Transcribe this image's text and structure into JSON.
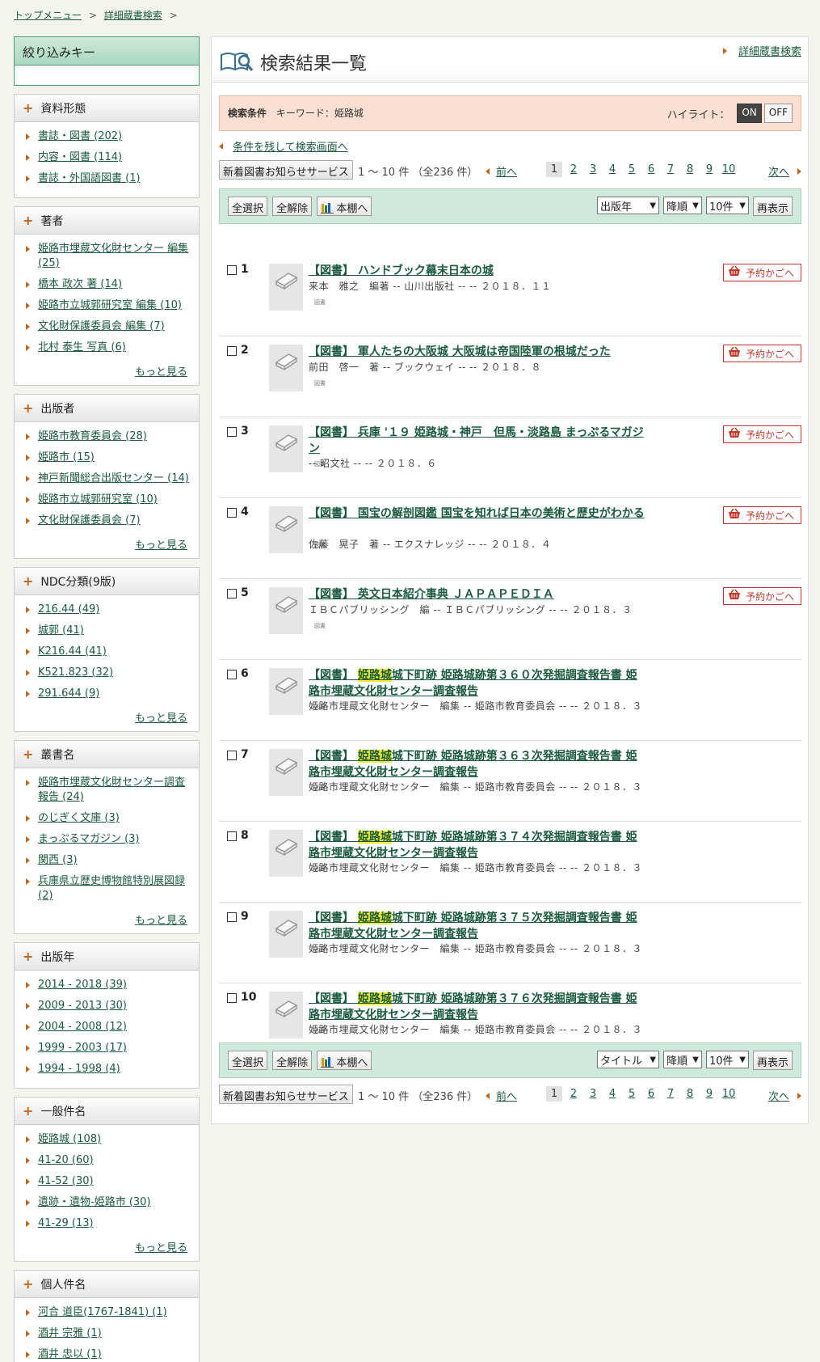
{
  "breadcrumb": {
    "items": [
      "トップメニュー",
      "詳細蔵書検索"
    ],
    "separator": ">"
  },
  "sidebar": {
    "title": "絞り込みキー",
    "more_label": "もっと見る",
    "facets": [
      {
        "title": "資料形態",
        "items": [
          "書誌・図書 (202)",
          "内容・図書 (114)",
          "書誌・外国語図書 (1)"
        ],
        "more": false
      },
      {
        "title": "著者",
        "items": [
          "姫路市埋蔵文化財センター 編集 (25)",
          "橋本 政次 著 (14)",
          "姫路市立城郭研究室 編集 (10)",
          "文化財保護委員会 編集 (7)",
          "北村 泰生 写真 (6)"
        ],
        "more": true
      },
      {
        "title": "出版者",
        "items": [
          "姫路市教育委員会 (28)",
          "姫路市 (15)",
          "神戸新聞総合出版センター (14)",
          "姫路市立城郭研究室 (10)",
          "文化財保護委員会 (7)"
        ],
        "more": true
      },
      {
        "title": "NDC分類(9版)",
        "items": [
          "216.44 (49)",
          "城郭 (41)",
          "K216.44 (41)",
          "K521.823 (32)",
          "291.644 (9)"
        ],
        "more": true
      },
      {
        "title": "叢書名",
        "items": [
          "姫路市埋蔵文化財センター調査報告 (24)",
          "のじぎく文庫 (3)",
          "まっぷるマガジン (3)",
          "関西 (3)",
          "兵庫県立歴史博物館特別展図録 (2)"
        ],
        "more": true
      },
      {
        "title": "出版年",
        "items": [
          "2014 - 2018 (39)",
          "2009 - 2013 (30)",
          "2004 - 2008 (12)",
          "1999 - 2003 (17)",
          "1994 - 1998 (4)"
        ],
        "more": false
      },
      {
        "title": "一般件名",
        "items": [
          "姫路城 (108)",
          "41-20 (60)",
          "41-52 (30)",
          "遺跡・遺物-姫路市 (30)",
          "41-29 (13)"
        ],
        "more": true
      },
      {
        "title": "個人件名",
        "items": [
          "河合 道臣(1767-1841) (1)",
          "酒井 宗雅 (1)",
          "酒井 忠以 (1)"
        ],
        "more": false
      }
    ]
  },
  "main": {
    "title": "検索結果一覧",
    "adv_search_link": "詳細蔵書検索",
    "condition": {
      "label": "検索条件",
      "text": "キーワード：姫路城",
      "highlight_label": "ハイライト：",
      "on_label": "ON",
      "off_label": "OFF"
    },
    "back_link": "条件を残して検索画面へ",
    "pager": {
      "service_button": "新着図書お知らせサービス",
      "range_text": "1 ～ 10 件 （全236 件）",
      "prev_label": "前へ",
      "next_label": "次へ",
      "pages": [
        "1",
        "2",
        "3",
        "4",
        "5",
        "6",
        "7",
        "8",
        "9",
        "10"
      ],
      "current_page": "1"
    },
    "toolbar_top": {
      "select_all": "全選択",
      "deselect_all": "全解除",
      "shelf": "本棚へ",
      "sort_field": "出版年",
      "sort_order": "降順",
      "per_page": "10件",
      "redisplay": "再表示"
    },
    "toolbar_bottom": {
      "select_all": "全選択",
      "deselect_all": "全解除",
      "shelf": "本棚へ",
      "sort_field": "タイトル",
      "sort_order": "降順",
      "per_page": "10件",
      "redisplay": "再表示"
    },
    "thumb_caption": "図書",
    "reserve_label": "予約かごへ",
    "results": [
      {
        "num": "1",
        "title_pre": "【図書】 ハンドブック幕末日本の城",
        "hl": "",
        "title_post": "",
        "meta": "来本　雅之　編著 -- 山川出版社 -- -- ２０１８．１１",
        "reserve": true
      },
      {
        "num": "2",
        "title_pre": "【図書】 軍人たちの大阪城 大阪城は帝国陸軍の根城だった",
        "hl": "",
        "title_post": "",
        "meta": "前田　啓一　著 -- ブックウェイ -- -- ２０１８．８",
        "reserve": true
      },
      {
        "num": "3",
        "title_pre": "【図書】 兵庫 '１９ 姫路城・神戸　但馬・淡路島 まっぷるマガジン",
        "hl": "",
        "title_post": "",
        "meta": "-- 昭文社 -- -- ２０１８．６",
        "reserve": true
      },
      {
        "num": "4",
        "title_pre": "【図書】 国宝の解剖図鑑 国宝を知れば日本の美術と歴史がわかる",
        "hl": "",
        "title_post": "",
        "meta": "佐藤　晃子　著 -- エクスナレッジ -- -- ２０１８．４",
        "reserve": true
      },
      {
        "num": "5",
        "title_pre": "【図書】 英文日本紹介事典 ＪＡＰＡＰＥＤＩＡ",
        "hl": "",
        "title_post": "",
        "meta": "ＩＢＣパブリッシング　編 -- ＩＢＣパブリッシング -- -- ２０１８．３",
        "reserve": true
      },
      {
        "num": "6",
        "title_pre": "【図書】 ",
        "hl": "姫路城",
        "title_post": "城下町跡 姫路城跡第３６０次発掘調査報告書 姫路市埋蔵文化財センター調査報告",
        "meta": "姫路市埋蔵文化財センター　編集 -- 姫路市教育委員会 -- -- ２０１８．３",
        "reserve": false
      },
      {
        "num": "7",
        "title_pre": "【図書】 ",
        "hl": "姫路城",
        "title_post": "城下町跡 姫路城跡第３６３次発掘調査報告書 姫路市埋蔵文化財センター調査報告",
        "meta": "姫路市埋蔵文化財センター　編集 -- 姫路市教育委員会 -- -- ２０１８．３",
        "reserve": false
      },
      {
        "num": "8",
        "title_pre": "【図書】 ",
        "hl": "姫路城",
        "title_post": "城下町跡 姫路城跡第３７４次発掘調査報告書 姫路市埋蔵文化財センター調査報告",
        "meta": "姫路市埋蔵文化財センター　編集 -- 姫路市教育委員会 -- -- ２０１８．３",
        "reserve": false
      },
      {
        "num": "9",
        "title_pre": "【図書】 ",
        "hl": "姫路城",
        "title_post": "城下町跡 姫路城跡第３７５次発掘調査報告書 姫路市埋蔵文化財センター調査報告",
        "meta": "姫路市埋蔵文化財センター　編集 -- 姫路市教育委員会 -- -- ２０１８．３",
        "reserve": false
      },
      {
        "num": "10",
        "title_pre": "【図書】 ",
        "hl": "姫路城",
        "title_post": "城下町跡 姫路城跡第３７６次発掘調査報告書 姫路市埋蔵文化財センター調査報告",
        "meta": "姫路市埋蔵文化財センター　編集 -- 姫路市教育委員会 -- -- ２０１８．３",
        "reserve": false
      }
    ]
  },
  "colors": {
    "accent_green": "#1a5a3e",
    "arrow_orange": "#c0651a",
    "highlight_yellow": "#f7ef2a",
    "reserve_red": "#c0392b"
  }
}
